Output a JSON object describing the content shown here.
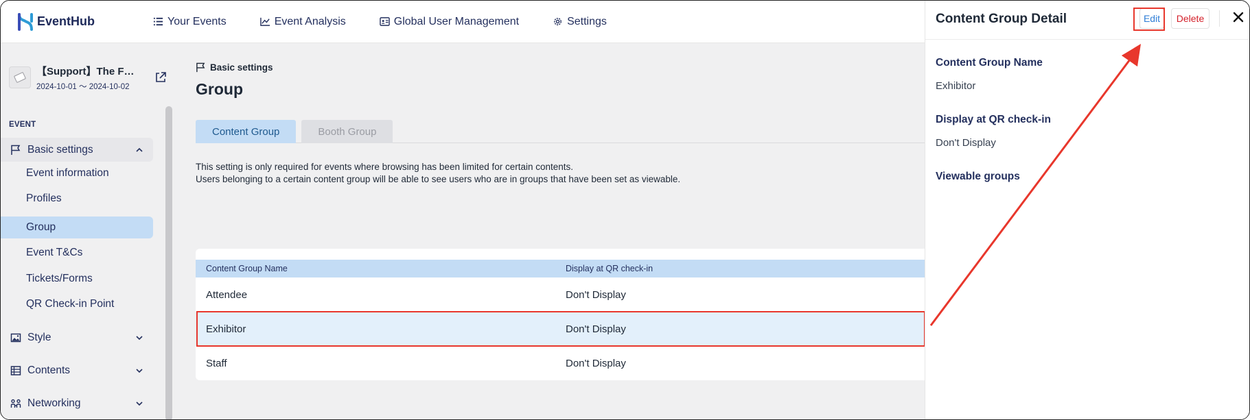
{
  "header": {
    "brand": "EventHub",
    "nav": [
      {
        "label": "Your Events",
        "icon": "list-icon"
      },
      {
        "label": "Event Analysis",
        "icon": "chart-line-icon"
      },
      {
        "label": "Global User Management",
        "icon": "id-card-icon"
      },
      {
        "label": "Settings",
        "icon": "gear-icon"
      }
    ]
  },
  "sidebar": {
    "event": {
      "title": "【Support】The F…",
      "dates": "2024-10-01 ～ 2024-10-02"
    },
    "section_label": "EVENT",
    "groups": [
      {
        "label": "Basic settings",
        "icon": "flag-icon",
        "expanded": true,
        "children": [
          {
            "label": "Event information"
          },
          {
            "label": "Profiles"
          },
          {
            "label": "Group",
            "active": true
          },
          {
            "label": "Event T&Cs"
          },
          {
            "label": "Tickets/Forms"
          },
          {
            "label": "QR Check-in Point"
          }
        ]
      },
      {
        "label": "Style",
        "icon": "image-icon",
        "expanded": false
      },
      {
        "label": "Contents",
        "icon": "table-icon",
        "expanded": false
      },
      {
        "label": "Networking",
        "icon": "users-link-icon",
        "expanded": false
      }
    ]
  },
  "main": {
    "breadcrumb": "Basic settings",
    "title": "Group",
    "tabs": [
      {
        "label": "Content Group",
        "active": true
      },
      {
        "label": "Booth Group",
        "active": false
      }
    ],
    "description": [
      "This setting is only required for events where browsing has been limited for certain contents.",
      "Users belonging to a certain content group will be able to see users who are in groups that have been set as viewable."
    ],
    "table": {
      "columns": [
        "Content Group Name",
        "Display at QR check-in"
      ],
      "rows": [
        {
          "name": "Attendee",
          "display": "Don't Display"
        },
        {
          "name": "Exhibitor",
          "display": "Don't Display",
          "selected": true
        },
        {
          "name": "Staff",
          "display": "Don't Display"
        }
      ]
    }
  },
  "panel": {
    "title": "Content Group Detail",
    "edit_label": "Edit",
    "delete_label": "Delete",
    "fields": [
      {
        "label": "Content Group Name",
        "value": "Exhibitor"
      },
      {
        "label": "Display at QR check-in",
        "value": "Don't Display"
      },
      {
        "label": "Viewable groups",
        "value": ""
      }
    ]
  },
  "colors": {
    "accent_blue": "#c3dcf5",
    "link_blue": "#2e7dd6",
    "danger_red": "#d4202a",
    "annotation_red": "#e8372c"
  }
}
